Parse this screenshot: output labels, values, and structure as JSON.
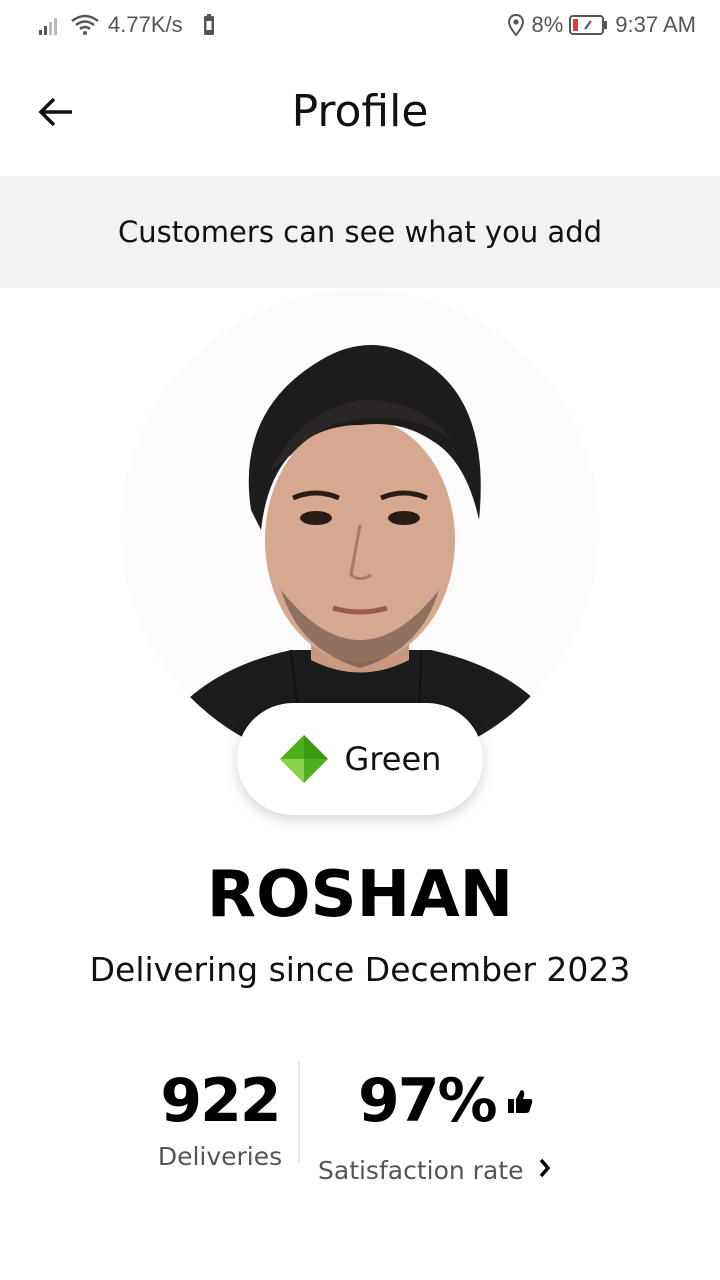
{
  "status_bar": {
    "network_speed": "4.77K/s",
    "battery_percent": "8%",
    "time": "9:37 AM",
    "icons": [
      "signal-icon",
      "wifi-icon",
      "battery-saver-icon",
      "location-icon",
      "battery-low-icon"
    ]
  },
  "header": {
    "title": "Profile",
    "back_icon": "arrow-left-icon"
  },
  "banner": {
    "text": "Customers can see what you add"
  },
  "profile": {
    "tier": {
      "label": "Green",
      "color": "#4caf1c",
      "icon": "diamond-icon"
    },
    "name": "ROSHAN",
    "since": "Delivering since December 2023"
  },
  "stats": {
    "deliveries": {
      "value": "922",
      "label": "Deliveries"
    },
    "satisfaction": {
      "value": "97%",
      "label": "Satisfaction rate",
      "icon": "thumbs-up-icon",
      "chevron": "chevron-right-icon"
    }
  }
}
